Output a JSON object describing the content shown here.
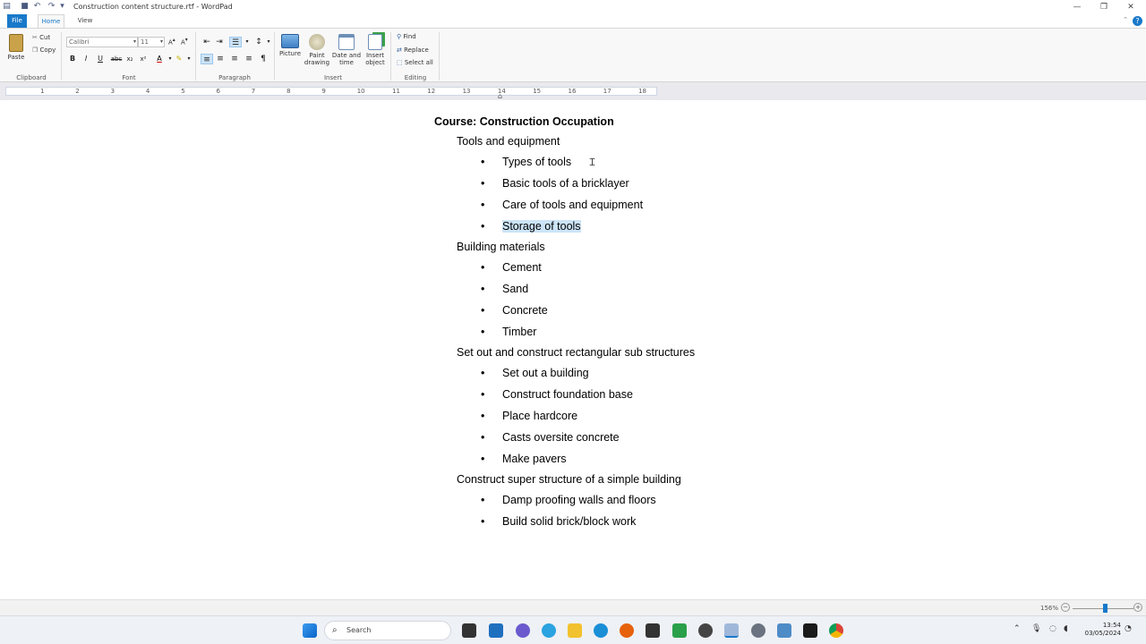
{
  "window": {
    "title": "Construction content structure.rtf - WordPad",
    "controls": {
      "minimize": "—",
      "restore": "❐",
      "close": "✕"
    }
  },
  "quick_access": {
    "save_icon": "💾",
    "undo_icon": "↶",
    "redo_icon": "↷",
    "customize_icon": "▾"
  },
  "tabs": [
    {
      "label": "File"
    },
    {
      "label": "Home"
    },
    {
      "label": "View"
    }
  ],
  "ribbon": {
    "clipboard": {
      "paste": "Paste",
      "cut": "Cut",
      "copy": "Copy",
      "label": "Clipboard"
    },
    "font": {
      "family": "Calibri",
      "size": "11",
      "label": "Font",
      "bold": "B",
      "italic": "I",
      "underline": "U",
      "strike": "abc",
      "sub": "x₂",
      "sup": "x²"
    },
    "paragraph": {
      "label": "Paragraph"
    },
    "insert": {
      "picture": "Picture",
      "paint_drawing": "Paint drawing",
      "date_time": "Date and time",
      "insert_object": "Insert object",
      "label": "Insert"
    },
    "editing": {
      "find": "Find",
      "replace": "Replace",
      "select_all": "Select all",
      "label": "Editing"
    }
  },
  "ruler": {
    "ticks": [
      "1",
      "2",
      "3",
      "4",
      "5",
      "6",
      "7",
      "8",
      "9",
      "10",
      "11",
      "12",
      "13",
      "14",
      "15",
      "16",
      "17",
      "18"
    ]
  },
  "document": {
    "heading": "Course: Construction Occupation",
    "sections": [
      {
        "title": "Tools and equipment",
        "items": [
          "Types of tools",
          "Basic tools of a bricklayer",
          "Care of tools and equipment",
          "Storage of tools"
        ]
      },
      {
        "title": "Building materials",
        "items": [
          "Cement",
          "Sand",
          "Concrete",
          "Timber"
        ]
      },
      {
        "title": "Set out and construct rectangular sub structures",
        "items": [
          "Set out a building",
          "Construct foundation base",
          "Place hardcore",
          "Casts oversite concrete",
          "Make pavers"
        ]
      },
      {
        "title": "Construct super structure of a simple building",
        "items": [
          "Damp proofing walls and floors",
          "Build solid brick/block work"
        ]
      }
    ],
    "selected_item": "Storage of tools"
  },
  "status": {
    "zoom": "156%",
    "zoom_level_percent": 156
  },
  "taskbar": {
    "search_placeholder": "Search",
    "time": "13:54",
    "date": "03/05/2024"
  },
  "colors": {
    "accent": "#1979ca",
    "selection": "#cce4f7"
  }
}
